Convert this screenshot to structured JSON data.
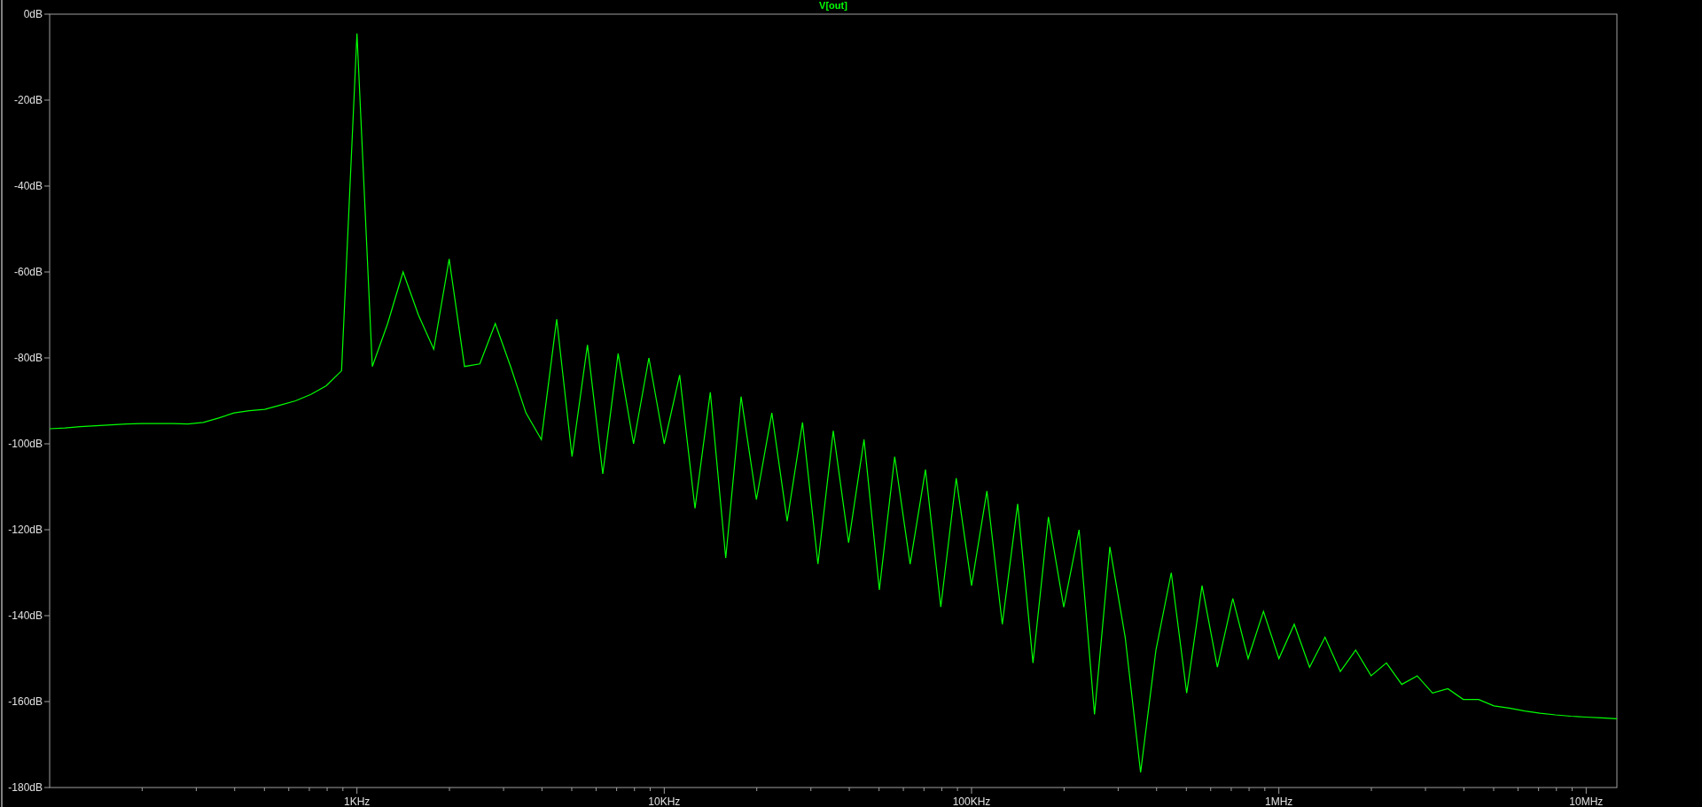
{
  "chart_data": {
    "type": "line",
    "title": "V[out]",
    "ylim": [
      -180,
      0
    ],
    "categories": [
      null,
      null,
      null,
      null,
      null,
      null,
      null,
      null,
      null,
      null,
      null,
      null,
      null,
      null,
      null,
      null,
      null,
      null,
      null,
      null,
      "1KHz",
      null,
      null,
      null,
      null,
      null,
      null,
      null,
      null,
      null,
      null,
      null,
      null,
      null,
      null,
      null,
      null,
      null,
      null,
      null,
      "10KHz",
      null,
      null,
      null,
      null,
      null,
      null,
      null,
      null,
      null,
      null,
      null,
      null,
      null,
      null,
      null,
      null,
      null,
      null,
      null,
      "100KHz",
      null,
      null,
      null,
      null,
      null,
      null,
      null,
      null,
      null,
      null,
      null,
      null,
      null,
      null,
      null,
      null,
      null,
      null,
      null,
      "1MHz",
      null,
      null,
      null,
      null,
      null,
      null,
      null,
      null,
      null,
      null,
      null,
      null,
      null,
      null,
      null,
      null,
      null,
      null,
      null,
      "10MHz",
      null,
      null
    ],
    "yticks": [
      {
        "value": 0,
        "label": "0dB"
      },
      {
        "value": -20,
        "label": "-20dB"
      },
      {
        "value": -40,
        "label": "-40dB"
      },
      {
        "value": -60,
        "label": "-60dB"
      },
      {
        "value": -80,
        "label": "-80dB"
      },
      {
        "value": -100,
        "label": "-100dB"
      },
      {
        "value": -120,
        "label": "-120dB"
      },
      {
        "value": -140,
        "label": "-140dB"
      },
      {
        "value": -160,
        "label": "-160dB"
      },
      {
        "value": -180,
        "label": "-180dB"
      }
    ],
    "series": [
      {
        "color": "#00ff00",
        "values": [
          -96.5,
          -96.3,
          -96,
          -95.8,
          -95.6,
          -95.4,
          -95.3,
          -95.3,
          -95.3,
          -95.4,
          -95,
          -94,
          -92.8,
          -92.3,
          -92,
          -91,
          -90,
          -88.5,
          -86.5,
          -83,
          -4.5,
          -82,
          -72,
          -60,
          -70,
          -78,
          -57,
          -82,
          -81.4,
          -72,
          -82,
          -92.8,
          -99,
          -71,
          -103,
          -77,
          -107,
          -79,
          -100,
          -80,
          -100,
          -84,
          -115,
          -88,
          -126.6,
          -89,
          -113,
          -92.8,
          -118,
          -95,
          -128,
          -97,
          -123,
          -99,
          -134,
          -103,
          -128,
          -106,
          -138,
          -108,
          -133,
          -111,
          -142,
          -114,
          -151,
          -117,
          -138,
          -120,
          -163,
          -124,
          -145,
          -176.5,
          -148,
          -130,
          -158,
          -133,
          -152,
          -136,
          -150,
          -139,
          -150,
          -142,
          -152,
          -145,
          -153,
          -148,
          -154,
          -151,
          -156,
          -154,
          -158,
          -157,
          -159.5,
          -159.5,
          -161,
          -161.5,
          -162.2,
          -162.7,
          -163.1,
          -163.4,
          -163.6,
          -163.8,
          -164
        ]
      }
    ]
  }
}
